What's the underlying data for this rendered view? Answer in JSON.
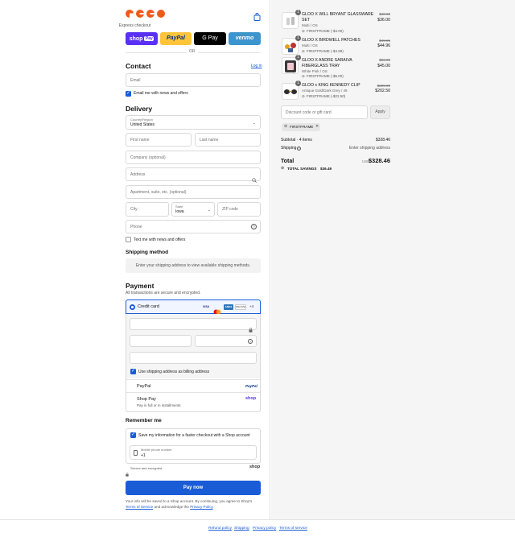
{
  "header": {
    "brand_logo": "gloo-logo",
    "bag_icon": "shopping-bag-icon",
    "express_checkout": "Express checkout",
    "shop_pay_label": "shop",
    "shop_pay_badge": "Pay",
    "paypal_label": "PayPal",
    "gpay_label": "G Pay",
    "venmo_label": "venmo",
    "or": "OR"
  },
  "contact": {
    "heading": "Contact",
    "login": "Log in",
    "email_placeholder": "Email",
    "news_label": "Email me with news and offers"
  },
  "delivery": {
    "heading": "Delivery",
    "country_label": "Country/Region",
    "country_value": "United States",
    "first_name": "First name",
    "last_name": "Last name",
    "company": "Company (optional)",
    "address": "Address",
    "apartment": "Apartment, suite, etc. (optional)",
    "city": "City",
    "state_label": "State",
    "state_value": "Iowa",
    "zip": "ZIP code",
    "phone": "Phone",
    "text_news": "Text me with news and offers"
  },
  "shipping": {
    "heading": "Shipping method",
    "notice": "Enter your shipping address to view available shipping methods."
  },
  "payment": {
    "heading": "Payment",
    "secure_note": "All transactions are secure and encrypted.",
    "credit_card": "Credit card",
    "card_brands": [
      "VISA",
      "mastercard",
      "AMEX",
      "DISCOVER"
    ],
    "more_brands": "+4",
    "billing_same": "Use shipping address as billing address",
    "paypal": "PayPal",
    "paypal_logo": "PayPal",
    "shop_pay": "Shop Pay",
    "shop_pay_sub": "Pay in full or in installments",
    "shop_logo": "shop"
  },
  "remember": {
    "heading": "Remember me",
    "save_info": "Save my information for a faster checkout with a Shop account",
    "mobile_label": "Mobile phone number",
    "mobile_value": "+1",
    "secure": "Secure and encrypted",
    "shop_logo": "shop"
  },
  "pay_button": "Pay now",
  "legal": {
    "text1": "Your info will be saved to a Shop account. By continuing, you agree to Shop's",
    "terms": "Terms of Service",
    "text2": "and acknowledge the",
    "privacy": "Privacy Policy",
    "text3": "."
  },
  "footer": {
    "links": [
      "Refund policy",
      "Shipping",
      "Privacy policy",
      "Terms of service"
    ]
  },
  "cart": {
    "items": [
      {
        "qty": "1",
        "title": "GLOO X WILL BRYANT GLASSWARE SET",
        "variant": "Multi / OS",
        "discount": "FIRSTFRAME (-$4.00)",
        "old_price": "$40.00",
        "price": "$36.00"
      },
      {
        "qty": "1",
        "title": "GLOO X BIRDWELL PATCHES",
        "variant": "Multi / OS",
        "discount": "FIRSTFRAME (-$4.99)",
        "old_price": "$49.95",
        "price": "$44.96"
      },
      {
        "qty": "1",
        "title": "GLOO X ANDRE SARAIVA FIBERGLASS TRAY",
        "variant": "White Pink / OS",
        "discount": "FIRSTFRAME (-$5.00)",
        "old_price": "$50.00",
        "price": "$45.00"
      },
      {
        "qty": "1",
        "title": "GLOO x KING KENNEDY CLIP",
        "variant": "Antique Gold/Dark Grey / 49",
        "discount": "FIRSTFRAME (-$22.50)",
        "old_price": "$225.00",
        "price": "$202.50"
      }
    ],
    "discount_placeholder": "Discount code or gift card",
    "apply": "Apply",
    "applied_code": "FIRSTFRAME",
    "subtotal_label": "Subtotal · 4 items",
    "subtotal_value": "$328.46",
    "shipping_label": "Shipping",
    "shipping_value": "Enter shipping address",
    "total_label": "Total",
    "currency": "USD",
    "total_value": "$328.46",
    "savings_label": "TOTAL SAVINGS",
    "savings_value": "$36.49"
  },
  "colors": {
    "accent": "#1a5cd6",
    "brand_orange": "#f05a1a",
    "shop_purple": "#5a31f4",
    "paypal_yellow": "#ffc439",
    "venmo_blue": "#3d95ce"
  }
}
